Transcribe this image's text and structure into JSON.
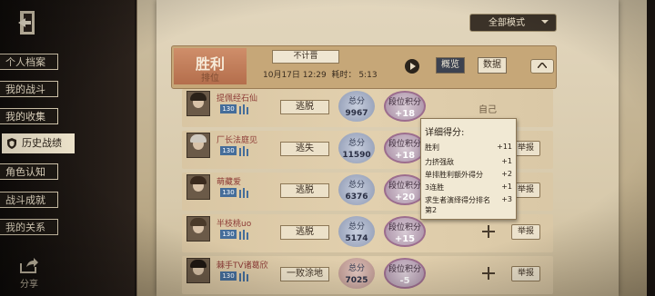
{
  "sidebar": {
    "items": [
      {
        "label": "个人档案"
      },
      {
        "label": "我的战斗"
      },
      {
        "label": "我的收集"
      },
      {
        "label": "历史战绩"
      },
      {
        "label": "角色认知"
      },
      {
        "label": "战斗成就"
      },
      {
        "label": "我的关系"
      }
    ],
    "share_label": "分享"
  },
  "filter": {
    "mode_label": "全部模式"
  },
  "summary": {
    "result": "胜利",
    "sub": "排位",
    "match_type": "不计晋",
    "date_time": "10月17日 12:29",
    "duration_label": "耗时：",
    "duration": "5:13",
    "tab_overview": "概览",
    "tab_data": "数据"
  },
  "players": [
    {
      "name": "提佩经石仙",
      "level": "130",
      "outcome": "逃脱",
      "score_label": "总分",
      "score": "9967",
      "rank_label": "段位积分",
      "rank_delta": "+18",
      "action": "自己"
    },
    {
      "name": "厂长法庭见",
      "level": "130",
      "outcome": "逃失",
      "score_label": "总分",
      "score": "11590",
      "rank_label": "段位积分",
      "rank_delta": "+18",
      "action": "举报"
    },
    {
      "name": "萌藏爱",
      "level": "130",
      "outcome": "逃脱",
      "score_label": "总分",
      "score": "6376",
      "rank_label": "段位积分",
      "rank_delta": "+20",
      "action": "举报"
    },
    {
      "name": "半枝桃uo",
      "level": "130",
      "outcome": "逃脱",
      "score_label": "总分",
      "score": "5174",
      "rank_label": "段位积分",
      "rank_delta": "+15",
      "action": "举报"
    },
    {
      "name": "棘手TV诸葛欣",
      "level": "130",
      "outcome": "一败涂地",
      "score_label": "总分",
      "score": "7025",
      "rank_label": "段位积分",
      "rank_delta": "-5",
      "action": "举报"
    }
  ],
  "tooltip": {
    "title": "详细得分:",
    "rows": [
      {
        "label": "胜利",
        "value": "+11"
      },
      {
        "label": "力挤强敌",
        "value": "+1"
      },
      {
        "label": "单排胜利额外得分",
        "value": "+2"
      },
      {
        "label": "3连胜",
        "value": "+1"
      },
      {
        "label": "求生者演绎得分排名第2",
        "value": "+3"
      }
    ]
  },
  "colors": {
    "accent_result": "#c07a57",
    "player_name": "#8d3b36",
    "level_badge": "#456d9a"
  }
}
